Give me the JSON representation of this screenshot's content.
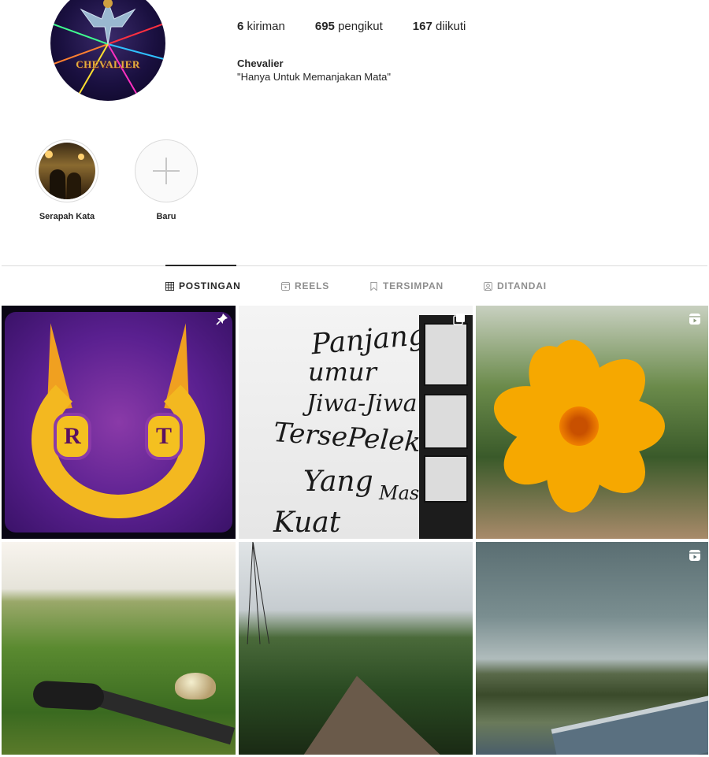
{
  "profile": {
    "avatar_text": "CHEVALIER",
    "stats": {
      "posts_count": "6",
      "posts_label": "kiriman",
      "followers_count": "695",
      "followers_label": "pengikut",
      "following_count": "167",
      "following_label": "diikuti"
    },
    "bio": {
      "name": "Chevalier",
      "text": "\"Hanya Untuk Memanjakan Mata\""
    }
  },
  "highlights": [
    {
      "label": "Serapah Kata"
    },
    {
      "label": "Baru"
    }
  ],
  "tabs": [
    {
      "label": "POSTINGAN",
      "icon": "grid-icon",
      "active": true
    },
    {
      "label": "REELS",
      "icon": "reels-icon",
      "active": false
    },
    {
      "label": "TERSIMPAN",
      "icon": "bookmark-icon",
      "active": false
    },
    {
      "label": "DITANDAI",
      "icon": "tagged-icon",
      "active": false
    }
  ],
  "posts": [
    {
      "kind": "image",
      "badge": "pin-icon",
      "letters": [
        "R",
        "T"
      ]
    },
    {
      "kind": "image",
      "badge": "carousel-icon",
      "graffiti": [
        "Panjang",
        "umur",
        "Jiwa-Jiwa",
        "TersePelekan",
        "Yang",
        "Masih",
        "Kuat"
      ]
    },
    {
      "kind": "reel",
      "badge": "reels-icon"
    },
    {
      "kind": "image",
      "badge": ""
    },
    {
      "kind": "image",
      "badge": ""
    },
    {
      "kind": "reel",
      "badge": "reels-icon"
    }
  ],
  "colors": {
    "text": "#262626",
    "muted": "#8e8e8e",
    "divider": "#dbdbdb"
  }
}
